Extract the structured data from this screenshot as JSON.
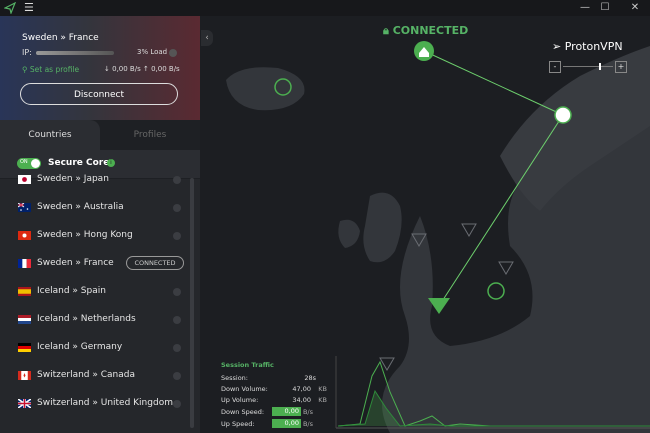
{
  "titlebar": {
    "menu_icon": "hamburger-icon",
    "minimize": "—",
    "maximize": "☐",
    "close": "✕"
  },
  "connection": {
    "title": "Sweden » France",
    "ip_label": "IP:",
    "load": "3% Load",
    "set_profile": "Set as profile",
    "download": "0,00 B/s",
    "upload": "0,00 B/s",
    "disconnect": "Disconnect"
  },
  "tabs": {
    "countries": "Countries",
    "profiles": "Profiles"
  },
  "secure_core": {
    "toggle_text": "ON",
    "label": "Secure Core",
    "enabled": true
  },
  "servers": [
    {
      "label": "Sweden » Japan"
    },
    {
      "label": "Sweden » Australia"
    },
    {
      "label": "Sweden » Hong Kong"
    },
    {
      "label": "Sweden » France",
      "badge": "CONNECTED"
    },
    {
      "label": "Iceland » Spain"
    },
    {
      "label": "Iceland » Netherlands"
    },
    {
      "label": "Iceland » Germany"
    },
    {
      "label": "Switzerland » Canada"
    },
    {
      "label": "Switzerland » United Kingdom"
    }
  ],
  "map": {
    "status": "CONNECTED",
    "brand": "ProtonVPN",
    "zoom_minus": "-",
    "zoom_plus": "+",
    "accent": "#56b366"
  },
  "traffic": {
    "title": "Session Traffic",
    "rows": [
      {
        "label": "Session:",
        "value": "28s",
        "unit": ""
      },
      {
        "label": "Down Volume:",
        "value": "47,00",
        "unit": "KB"
      },
      {
        "label": "Up Volume:",
        "value": "34,00",
        "unit": "KB"
      },
      {
        "label": "Down Speed:",
        "value": "0,00",
        "unit": "B/s",
        "boxed": true
      },
      {
        "label": "Up Speed:",
        "value": "0,00",
        "unit": "B/s",
        "boxed": true
      }
    ]
  }
}
